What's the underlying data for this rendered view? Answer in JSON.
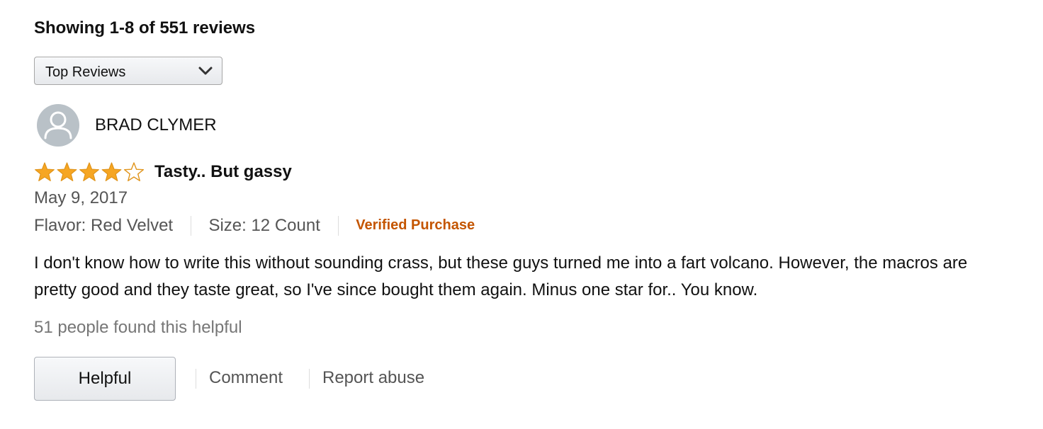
{
  "header": {
    "showing_text": "Showing 1-8 of 551 reviews"
  },
  "sort": {
    "selected": "Top Reviews"
  },
  "review": {
    "reviewer_name": "BRAD CLYMER",
    "rating": 4,
    "max_rating": 5,
    "title": "Tasty.. But gassy",
    "date": "May 9, 2017",
    "flavor": "Flavor: Red Velvet",
    "size": "Size: 12 Count",
    "verified": "Verified Purchase",
    "body": "I don't know how to write this without sounding crass, but these guys turned me into a fart volcano. However, the macros are pretty good and they taste great, so I've since bought them again. Minus one star for.. You know.",
    "helpful_count": "51 people found this helpful"
  },
  "actions": {
    "helpful_label": "Helpful",
    "comment_label": "Comment",
    "report_label": "Report abuse"
  },
  "colors": {
    "star": "#f6a623",
    "star_outline": "#e0941a",
    "verified": "#c45500",
    "avatar_bg": "#b9c1c7"
  },
  "icons": {
    "sort_chevron": "chevron-down-icon",
    "avatar": "user-icon",
    "star_filled": "star-filled-icon",
    "star_empty": "star-empty-icon"
  }
}
